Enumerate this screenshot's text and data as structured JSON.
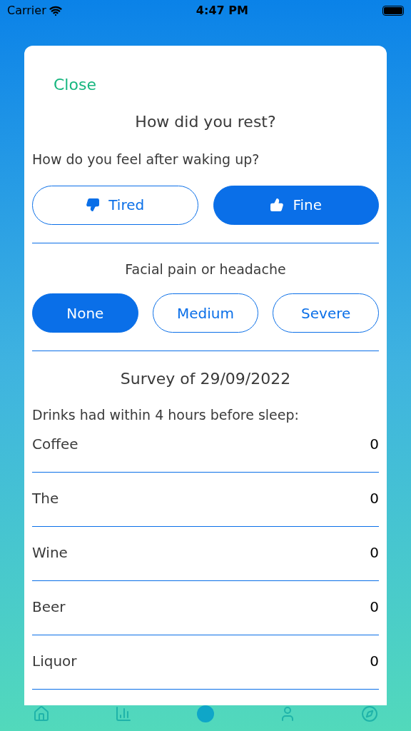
{
  "status_bar": {
    "carrier": "Carrier",
    "time": "4:47 PM"
  },
  "modal": {
    "close": "Close",
    "title": "How did you rest?",
    "wake_question": "How do you feel after waking up?",
    "wake_options": [
      {
        "label": "Tired",
        "kind": "negative",
        "selected": false
      },
      {
        "label": "Fine",
        "kind": "positive",
        "selected": true
      }
    ],
    "pain_question": "Facial pain or headache",
    "pain_options": [
      {
        "label": "None",
        "selected": true
      },
      {
        "label": "Medium",
        "selected": false
      },
      {
        "label": "Severe",
        "selected": false
      }
    ],
    "survey_title": "Survey of 29/09/2022",
    "drinks_label": "Drinks had within 4 hours before sleep:",
    "drinks": [
      {
        "name": "Coffee",
        "count": "0"
      },
      {
        "name": "The",
        "count": "0"
      },
      {
        "name": "Wine",
        "count": "0"
      },
      {
        "name": "Beer",
        "count": "0"
      },
      {
        "name": "Liquor",
        "count": "0"
      }
    ]
  }
}
